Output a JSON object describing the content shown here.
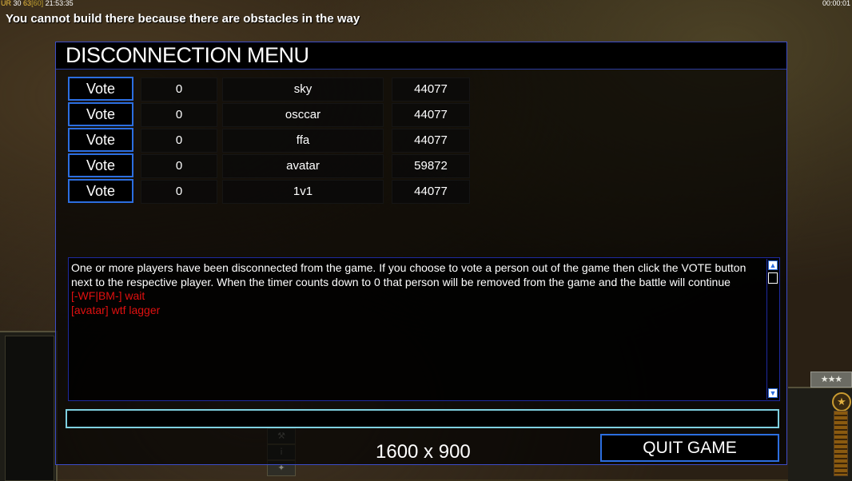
{
  "hud": {
    "ur_label": "UR",
    "ur_value": "30",
    "fps": "63",
    "fps_max": "[60]",
    "clock": "21:53:35",
    "game_timer": "00:00:01"
  },
  "notice": "You cannot build there because there are obstacles in the way",
  "dialog": {
    "title": "DISCONNECTION MENU",
    "vote_label": "Vote",
    "players": [
      {
        "timer": "0",
        "name": "sky",
        "id": "44077"
      },
      {
        "timer": "0",
        "name": "osccar",
        "id": "44077"
      },
      {
        "timer": "0",
        "name": "ffa",
        "id": "44077"
      },
      {
        "timer": "0",
        "name": "avatar",
        "id": "59872"
      },
      {
        "timer": "0",
        "name": "1v1",
        "id": "44077"
      }
    ],
    "chat": {
      "system_message": "One or more players have been disconnected from the game. If you choose to vote a person out of the game then click the VOTE button next to the respective player. When the timer counts down to 0 that person will be removed from the game and the battle will continue",
      "messages": [
        "[-WF|BM-] wait",
        "[avatar] wtf lagger"
      ]
    },
    "chat_input_value": "",
    "resolution": "1600 x 900",
    "quit_label": "QUIT GAME"
  },
  "colors": {
    "border_blue": "#2c6ee0",
    "input_border": "#7fd0e0",
    "chat_red": "#e01010"
  },
  "icons": {
    "rank": "three-stars-icon",
    "medal": "star-medal-icon"
  }
}
